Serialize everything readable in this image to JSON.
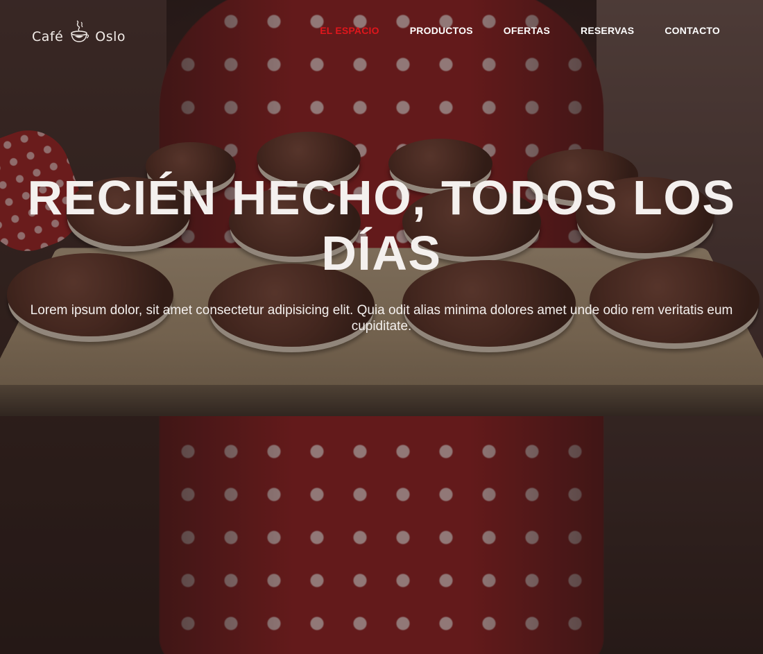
{
  "brand": {
    "name_left": "Café",
    "name_right": "Oslo"
  },
  "nav": {
    "items": [
      {
        "label": "EL ESPACIO",
        "active": true
      },
      {
        "label": "PRODUCTOS",
        "active": false
      },
      {
        "label": "OFERTAS",
        "active": false
      },
      {
        "label": "RESERVAS",
        "active": false
      },
      {
        "label": "CONTACTO",
        "active": false
      }
    ],
    "active_color": "#e0161c"
  },
  "hero": {
    "title": "RECIÉN HECHO, TODOS LOS DÍAS",
    "subtitle": "Lorem ipsum dolor, sit amet consectetur adipisicing elit. Quia odit alias minima dolores amet unde odio rem veritatis eum cupiditate."
  }
}
